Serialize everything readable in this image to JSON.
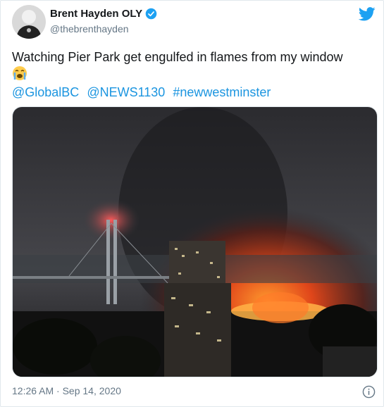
{
  "tweet": {
    "author_name": "Brent Hayden OLY",
    "handle": "@thebrenthayden",
    "text": "Watching Pier Park get engulfed in flames from my window",
    "emoji": "crying-face-emoji",
    "mentions": [
      "@GlobalBC",
      "@NEWS1130",
      "#newwestminster"
    ],
    "timestamp": "12:26 AM · Sep 14, 2020"
  },
  "colors": {
    "link": "#1b95e0",
    "twitter_blue": "#1da1f2",
    "secondary_text": "#657786"
  },
  "icons": [
    "verified-badge-icon",
    "twitter-bird-icon",
    "info-icon"
  ]
}
